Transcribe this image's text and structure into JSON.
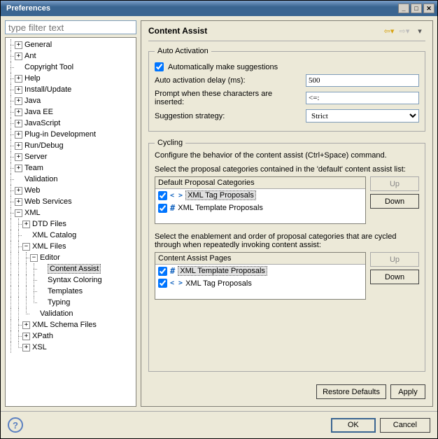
{
  "window": {
    "title": "Preferences"
  },
  "filter": {
    "placeholder": "type filter text"
  },
  "tree": {
    "general": "General",
    "ant": "Ant",
    "copyright": "Copyright Tool",
    "help": "Help",
    "install": "Install/Update",
    "java": "Java",
    "javaee": "Java EE",
    "javascript": "JavaScript",
    "plugin": "Plug-in Development",
    "rundebug": "Run/Debug",
    "server": "Server",
    "team": "Team",
    "validation": "Validation",
    "web": "Web",
    "webservices": "Web Services",
    "xml": "XML",
    "dtd": "DTD Files",
    "xmlcatalog": "XML Catalog",
    "xmlfiles": "XML Files",
    "editor": "Editor",
    "contentassist": "Content Assist",
    "syntax": "Syntax Coloring",
    "templates": "Templates",
    "typing": "Typing",
    "validation2": "Validation",
    "xmlschema": "XML Schema Files",
    "xpath": "XPath",
    "xsl": "XSL"
  },
  "page": {
    "title": "Content Assist",
    "auto_activation": {
      "legend": "Auto Activation",
      "auto_suggest": "Automatically make suggestions",
      "delay_label": "Auto activation delay (ms):",
      "delay_value": "500",
      "prompt_label": "Prompt when these characters are inserted:",
      "prompt_value": "<=:",
      "strategy_label": "Suggestion strategy:",
      "strategy_value": "Strict"
    },
    "cycling": {
      "legend": "Cycling",
      "desc": "Configure the behavior of the content assist (Ctrl+Space) command.",
      "default_label": "Select the proposal categories contained in the 'default' content assist list:",
      "default_header": "Default Proposal Categories",
      "default_items": [
        "XML Tag Proposals",
        "XML Template Proposals"
      ],
      "pages_label": "Select the enablement and order of proposal categories that are cycled through when repeatedly invoking content assist:",
      "pages_header": "Content Assist Pages",
      "pages_items": [
        "XML Template Proposals",
        "XML Tag Proposals"
      ],
      "up": "Up",
      "down": "Down"
    },
    "restore": "Restore Defaults",
    "apply": "Apply"
  },
  "footer": {
    "ok": "OK",
    "cancel": "Cancel"
  }
}
